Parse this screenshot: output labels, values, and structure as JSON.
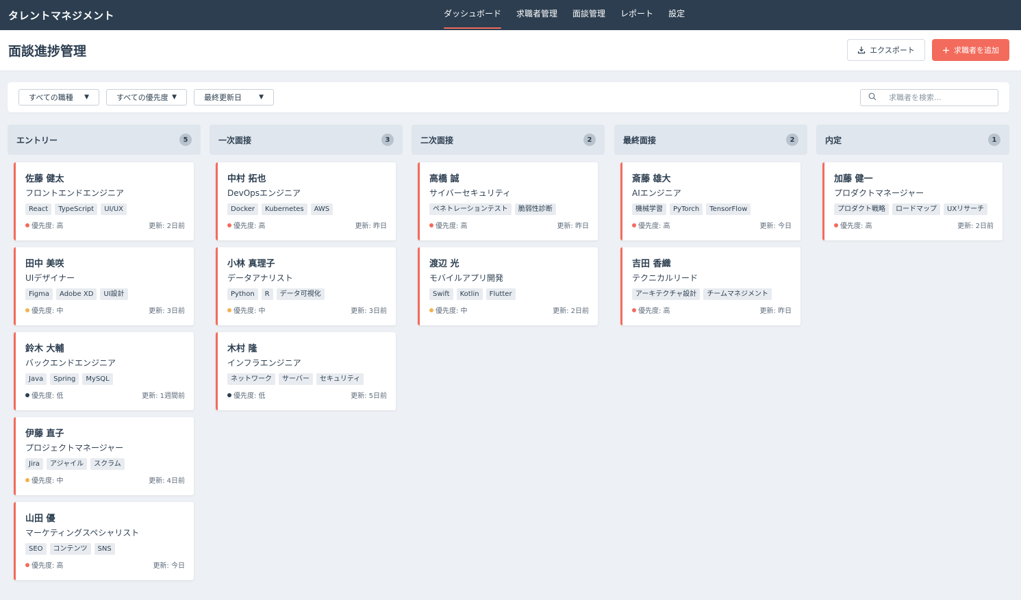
{
  "app": {
    "brand": "タレントマネジメント"
  },
  "nav": [
    {
      "label": "ダッシュボード",
      "active": true
    },
    {
      "label": "求職者管理",
      "active": false
    },
    {
      "label": "面談管理",
      "active": false
    },
    {
      "label": "レポート",
      "active": false
    },
    {
      "label": "設定",
      "active": false
    }
  ],
  "page": {
    "title": "面談進捗管理",
    "export_label": "エクスポート",
    "add_label": "求職者を追加"
  },
  "filters": {
    "job_type": "すべての職種",
    "priority": "すべての優先度",
    "sort": "最終更新日",
    "search_placeholder": "求職者を検索..."
  },
  "colors": {
    "accent": "#f36b5c",
    "high": "#f36b5c",
    "medium": "#f3b24f",
    "low": "#2c3e50",
    "header": "#2c3e50"
  },
  "columns": [
    {
      "title": "エントリー",
      "count": "5",
      "cards": [
        {
          "name": "佐藤 健太",
          "role": "フロントエンドエンジニア",
          "tags": [
            "React",
            "TypeScript",
            "UI/UX"
          ],
          "priority": "優先度: 高",
          "level": "high",
          "updated": "更新: 2日前"
        },
        {
          "name": "田中 美咲",
          "role": "UIデザイナー",
          "tags": [
            "Figma",
            "Adobe XD",
            "UI設計"
          ],
          "priority": "優先度: 中",
          "level": "medium",
          "updated": "更新: 3日前"
        },
        {
          "name": "鈴木 大輔",
          "role": "バックエンドエンジニア",
          "tags": [
            "Java",
            "Spring",
            "MySQL"
          ],
          "priority": "優先度: 低",
          "level": "low",
          "updated": "更新: 1週間前"
        },
        {
          "name": "伊藤 直子",
          "role": "プロジェクトマネージャー",
          "tags": [
            "Jira",
            "アジャイル",
            "スクラム"
          ],
          "priority": "優先度: 中",
          "level": "medium",
          "updated": "更新: 4日前"
        },
        {
          "name": "山田 優",
          "role": "マーケティングスペシャリスト",
          "tags": [
            "SEO",
            "コンテンツ",
            "SNS"
          ],
          "priority": "優先度: 高",
          "level": "high",
          "updated": "更新: 今日"
        }
      ]
    },
    {
      "title": "一次面接",
      "count": "3",
      "cards": [
        {
          "name": "中村 拓也",
          "role": "DevOpsエンジニア",
          "tags": [
            "Docker",
            "Kubernetes",
            "AWS"
          ],
          "priority": "優先度: 高",
          "level": "high",
          "updated": "更新: 昨日"
        },
        {
          "name": "小林 真理子",
          "role": "データアナリスト",
          "tags": [
            "Python",
            "R",
            "データ可視化"
          ],
          "priority": "優先度: 中",
          "level": "medium",
          "updated": "更新: 3日前"
        },
        {
          "name": "木村 隆",
          "role": "インフラエンジニア",
          "tags": [
            "ネットワーク",
            "サーバー",
            "セキュリティ"
          ],
          "priority": "優先度: 低",
          "level": "low",
          "updated": "更新: 5日前"
        }
      ]
    },
    {
      "title": "二次面接",
      "count": "2",
      "cards": [
        {
          "name": "高橋 誠",
          "role": "サイバーセキュリティ",
          "tags": [
            "ペネトレーションテスト",
            "脆弱性診断"
          ],
          "priority": "優先度: 高",
          "level": "high",
          "updated": "更新: 昨日"
        },
        {
          "name": "渡辺 光",
          "role": "モバイルアプリ開発",
          "tags": [
            "Swift",
            "Kotlin",
            "Flutter"
          ],
          "priority": "優先度: 中",
          "level": "medium",
          "updated": "更新: 2日前"
        }
      ]
    },
    {
      "title": "最終面接",
      "count": "2",
      "cards": [
        {
          "name": "斎藤 雄大",
          "role": "AIエンジニア",
          "tags": [
            "機械学習",
            "PyTorch",
            "TensorFlow"
          ],
          "priority": "優先度: 高",
          "level": "high",
          "updated": "更新: 今日"
        },
        {
          "name": "吉田 香織",
          "role": "テクニカルリード",
          "tags": [
            "アーキテクチャ設計",
            "チームマネジメント"
          ],
          "priority": "優先度: 高",
          "level": "high",
          "updated": "更新: 昨日"
        }
      ]
    },
    {
      "title": "内定",
      "count": "1",
      "cards": [
        {
          "name": "加藤 健一",
          "role": "プロダクトマネージャー",
          "tags": [
            "プロダクト戦略",
            "ロードマップ",
            "UXリサーチ"
          ],
          "priority": "優先度: 高",
          "level": "high",
          "updated": "更新: 2日前"
        }
      ]
    }
  ]
}
